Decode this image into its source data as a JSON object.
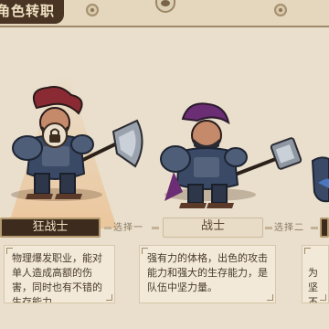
{
  "header": {
    "title": "角色转职"
  },
  "characters": [
    {
      "name": "狂战士",
      "locked": true,
      "description": "物理爆发职业，能对单人造成高额的伤害，同时也有不错的生存能力。"
    },
    {
      "name": "战士",
      "locked": false,
      "description": "强有力的体格，出色的攻击能力和强大的生存能力，是队伍中坚力量。"
    },
    {
      "name": "",
      "partial_description": "为坚\n不可"
    }
  ],
  "selectors": {
    "option_one": "选择一",
    "option_two": "选择二"
  },
  "colors": {
    "plate_dark": "#3d2b1e",
    "plate_border": "#b49a6f",
    "background": "#e9dfcc",
    "armor": "#3a4a66",
    "hair": "#8a2b34",
    "hair_purple": "#6b2d73"
  }
}
